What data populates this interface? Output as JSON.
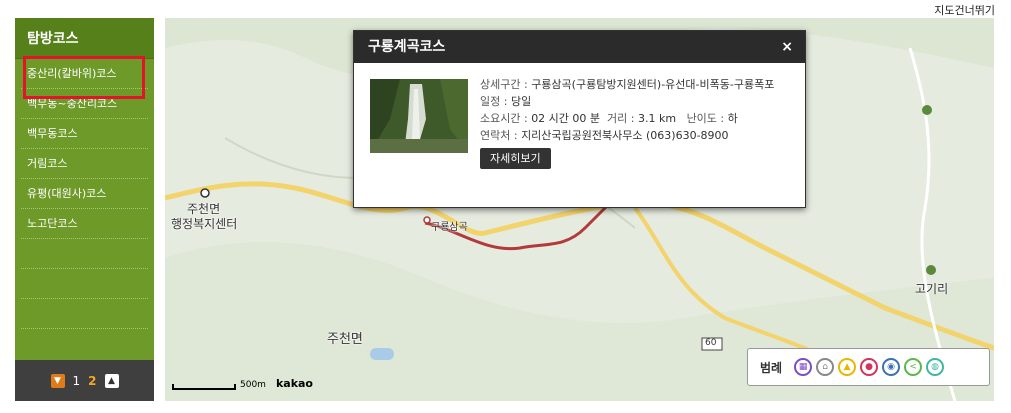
{
  "skip_link": "지도건너뛰기",
  "sidebar": {
    "title": "탐방코스",
    "items": [
      {
        "label": "중산리(칼바위)코스"
      },
      {
        "label": "백무동~중산리코스"
      },
      {
        "label": "백무동코스"
      },
      {
        "label": "거림코스"
      },
      {
        "label": "유평(대원사)코스"
      },
      {
        "label": "노고단코스"
      }
    ]
  },
  "pager": {
    "page1": "1",
    "page2": "2"
  },
  "map": {
    "labels": {
      "town": "주천면",
      "office": "행정복지센터",
      "start": "구룡삼곡",
      "area": "주천면",
      "village": "고기리",
      "road": "60"
    },
    "scale_label": "500m",
    "brand": "kakao"
  },
  "popup": {
    "title": "구룡계곡코스",
    "close": "×",
    "detail_label": "상세구간 : ",
    "detail_value": "구룡삼곡(구룡탐방지원센터)-유선대-비폭동-구룡폭포",
    "schedule_label": "일정 : ",
    "schedule_value": "당일",
    "time_label": "소요시간 : ",
    "time_value": "02 시간 00 분",
    "distance_label": "거리 : ",
    "distance_value": "3.1 km",
    "difficulty_label": "난이도 : ",
    "difficulty_value": "하",
    "contact_label": "연락처 : ",
    "contact_value": "지리산국립공원전북사무소 (063)630-8900",
    "more_button": "자세히보기"
  },
  "legend": {
    "title": "범례",
    "icons": [
      "restroom-icon",
      "shelter-icon",
      "camping-icon",
      "ranger-icon",
      "parking-icon",
      "viewpoint-icon",
      "drink-icon"
    ],
    "colors": [
      "#7a4cc7",
      "#888888",
      "#e6b800",
      "#d6335c",
      "#3b6fb6",
      "#5bb84a",
      "#3fb5a3"
    ]
  }
}
